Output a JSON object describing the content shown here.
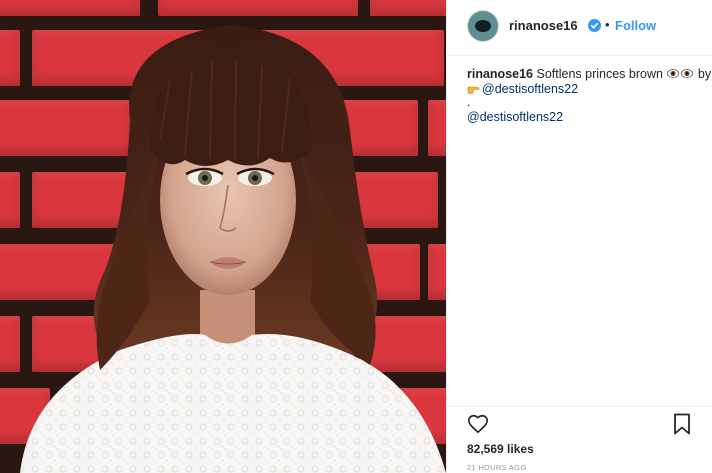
{
  "post": {
    "author": {
      "username": "rinanose16",
      "verified": true,
      "follow_label": "Follow",
      "separator": "•"
    },
    "caption": {
      "username": "rinanose16",
      "text": "Softlens princes brown",
      "by_word": "by",
      "mention_1": "@destisoftlens22",
      "period": ".",
      "mention_2": "@destisoftlens22"
    },
    "likes": {
      "count": "82,569",
      "label": "likes"
    },
    "timestamp": "21 HOURS AGO"
  },
  "icons": {
    "verified_badge": "verified-badge-icon",
    "eyes": "eye-emoji-icon",
    "pointing_hand": "pointing-hand-emoji-icon",
    "like": "heart-icon",
    "save": "bookmark-icon"
  },
  "colors": {
    "link_blue": "#3897f0",
    "mention": "#003569",
    "text": "#262626",
    "muted": "#999999",
    "border": "#efefef"
  }
}
